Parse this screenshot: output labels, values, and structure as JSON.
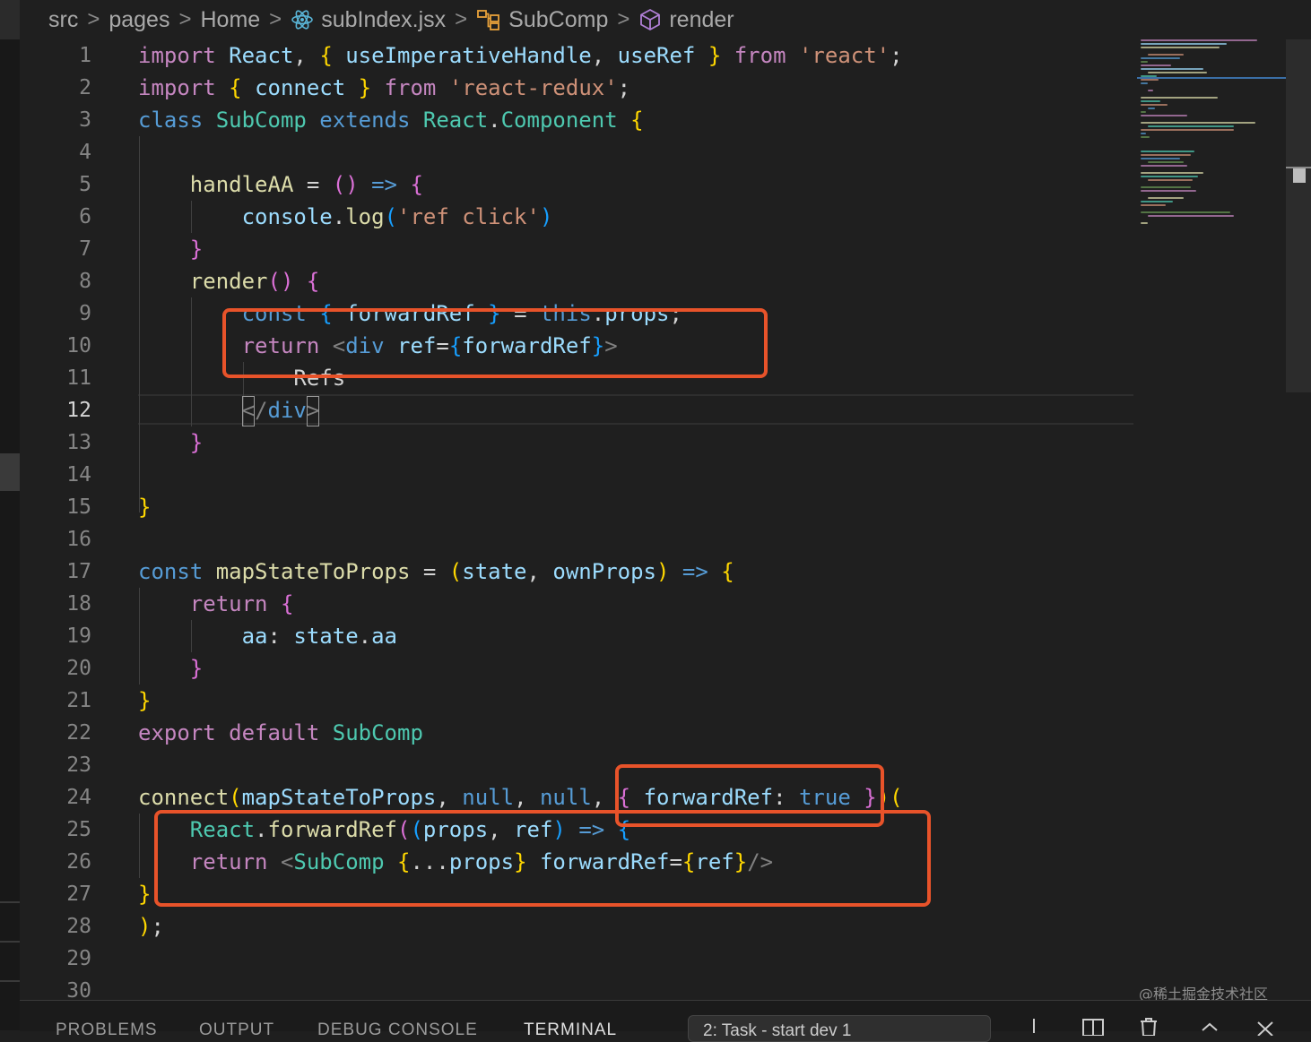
{
  "breadcrumb": [
    {
      "label": "src",
      "icon": null
    },
    {
      "label": "pages",
      "icon": null
    },
    {
      "label": "Home",
      "icon": null
    },
    {
      "label": "subIndex.jsx",
      "icon": "react-atom-icon"
    },
    {
      "label": "SubComp",
      "icon": "class-symbol-icon"
    },
    {
      "label": "render",
      "icon": "method-cube-icon"
    }
  ],
  "editor": {
    "active_line": 12,
    "line_numbers": [
      "1",
      "2",
      "3",
      "4",
      "5",
      "6",
      "7",
      "8",
      "9",
      "10",
      "11",
      "12",
      "13",
      "14",
      "15",
      "16",
      "17",
      "18",
      "19",
      "20",
      "21",
      "22",
      "23",
      "24",
      "25",
      "26",
      "27",
      "28",
      "29",
      "30"
    ],
    "lines": [
      [
        [
          "import ",
          "kw"
        ],
        [
          "React",
          "var"
        ],
        [
          ", ",
          "pl"
        ],
        [
          "{ ",
          "p1"
        ],
        [
          "useImperativeHandle",
          "var"
        ],
        [
          ", ",
          "pl"
        ],
        [
          "useRef",
          "var"
        ],
        [
          " }",
          "p1"
        ],
        [
          " from ",
          "kw"
        ],
        [
          "'react'",
          "str"
        ],
        [
          ";",
          "pl"
        ]
      ],
      [
        [
          "import ",
          "kw"
        ],
        [
          "{ ",
          "p1"
        ],
        [
          "connect",
          "var"
        ],
        [
          " }",
          "p1"
        ],
        [
          " from ",
          "kw"
        ],
        [
          "'react-redux'",
          "str"
        ],
        [
          ";",
          "pl"
        ]
      ],
      [
        [
          "class ",
          "st"
        ],
        [
          "SubComp ",
          "cl"
        ],
        [
          "extends ",
          "st"
        ],
        [
          "React",
          "cl"
        ],
        [
          ".",
          "pl"
        ],
        [
          "Component ",
          "cl"
        ],
        [
          "{",
          "p1"
        ]
      ],
      [],
      [
        [
          "    handleAA ",
          "fn"
        ],
        [
          "= ",
          "pl"
        ],
        [
          "() ",
          "p2"
        ],
        [
          "=> ",
          "st"
        ],
        [
          "{",
          "p2"
        ]
      ],
      [
        [
          "        console",
          "var"
        ],
        [
          ".",
          "pl"
        ],
        [
          "log",
          "fn"
        ],
        [
          "(",
          "p3"
        ],
        [
          "'ref click'",
          "str"
        ],
        [
          ")",
          "p3"
        ]
      ],
      [
        [
          "    }",
          "p2"
        ]
      ],
      [
        [
          "    render",
          "fn"
        ],
        [
          "() ",
          "p2"
        ],
        [
          "{",
          "p2"
        ]
      ],
      [
        [
          "        const ",
          "st"
        ],
        [
          "{ ",
          "p3"
        ],
        [
          "forwardRef ",
          "var"
        ],
        [
          "} ",
          "p3"
        ],
        [
          "= ",
          "pl"
        ],
        [
          "this",
          "st"
        ],
        [
          ".",
          "pl"
        ],
        [
          "props",
          "var"
        ],
        [
          ";",
          "pl"
        ]
      ],
      [
        [
          "        return ",
          "kw"
        ],
        [
          "<",
          "tg"
        ],
        [
          "div ",
          "st"
        ],
        [
          "ref",
          "var"
        ],
        [
          "=",
          "pl"
        ],
        [
          "{",
          "p3"
        ],
        [
          "forwardRef",
          "var"
        ],
        [
          "}",
          "p3"
        ],
        [
          ">",
          "tg"
        ]
      ],
      [
        [
          "            Refs",
          "pl"
        ]
      ],
      [
        [
          "        </",
          "tg"
        ],
        [
          "div",
          "st"
        ],
        [
          ">",
          "tg"
        ]
      ],
      [
        [
          "    }",
          "p2"
        ]
      ],
      [],
      [
        [
          "}",
          "p1"
        ]
      ],
      [],
      [
        [
          "const ",
          "st"
        ],
        [
          "mapStateToProps ",
          "fn"
        ],
        [
          "= ",
          "pl"
        ],
        [
          "(",
          "p1"
        ],
        [
          "state",
          "var"
        ],
        [
          ", ",
          "pl"
        ],
        [
          "ownProps",
          "var"
        ],
        [
          ") ",
          "p1"
        ],
        [
          "=> ",
          "st"
        ],
        [
          "{",
          "p1"
        ]
      ],
      [
        [
          "    return ",
          "kw"
        ],
        [
          "{",
          "p2"
        ]
      ],
      [
        [
          "        aa",
          "var"
        ],
        [
          ": ",
          "pl"
        ],
        [
          "state",
          "var"
        ],
        [
          ".",
          "pl"
        ],
        [
          "aa",
          "var"
        ]
      ],
      [
        [
          "    }",
          "p2"
        ]
      ],
      [
        [
          "}",
          "p1"
        ]
      ],
      [
        [
          "export ",
          "kw"
        ],
        [
          "default ",
          "kw"
        ],
        [
          "SubComp",
          "cl"
        ]
      ],
      [],
      [
        [
          "connect",
          "fn"
        ],
        [
          "(",
          "p1"
        ],
        [
          "mapStateToProps",
          "var"
        ],
        [
          ", ",
          "pl"
        ],
        [
          "null",
          "st"
        ],
        [
          ", ",
          "pl"
        ],
        [
          "null",
          "st"
        ],
        [
          ", ",
          "pl"
        ],
        [
          "{ ",
          "p2"
        ],
        [
          "forwardRef",
          "var"
        ],
        [
          ": ",
          "pl"
        ],
        [
          "true ",
          "st"
        ],
        [
          "}",
          "p2"
        ],
        [
          ")",
          "p1"
        ],
        [
          "(",
          "p1"
        ]
      ],
      [
        [
          "    React",
          "cl"
        ],
        [
          ".",
          "pl"
        ],
        [
          "forwardRef",
          "fn"
        ],
        [
          "(",
          "p2"
        ],
        [
          "(",
          "p3"
        ],
        [
          "props",
          "var"
        ],
        [
          ", ",
          "pl"
        ],
        [
          "ref",
          "var"
        ],
        [
          ") ",
          "p3"
        ],
        [
          "=> ",
          "st"
        ],
        [
          "{",
          "p3"
        ]
      ],
      [
        [
          "    return ",
          "kw"
        ],
        [
          "<",
          "tg"
        ],
        [
          "SubComp ",
          "cl"
        ],
        [
          "{",
          "p1"
        ],
        [
          "...",
          "pl"
        ],
        [
          "props",
          "var"
        ],
        [
          "} ",
          "p1"
        ],
        [
          "forwardRef",
          "var"
        ],
        [
          "=",
          "pl"
        ],
        [
          "{",
          "p1"
        ],
        [
          "ref",
          "var"
        ],
        [
          "}",
          "p1"
        ],
        [
          "/>",
          "tg"
        ]
      ],
      [
        [
          "}",
          "p1"
        ]
      ],
      [
        [
          ")",
          "p1"
        ],
        [
          ";",
          "pl"
        ]
      ],
      [],
      []
    ]
  },
  "panel": {
    "tabs": [
      "PROBLEMS",
      "OUTPUT",
      "DEBUG CONSOLE",
      "TERMINAL"
    ],
    "active_tab": "TERMINAL",
    "terminal_select": "2: Task - start dev 1",
    "actions": [
      "add-terminal-icon",
      "split-terminal-icon",
      "trash-icon",
      "maximize-chevron-icon",
      "close-icon"
    ]
  },
  "watermark": "@稀土掘金技术社区",
  "colors": {
    "background": "#1f1f1f",
    "annotation_red": "#e8532a",
    "keyword": "#c586c0",
    "storage": "#569cd6",
    "class": "#4ec9b0",
    "function": "#dcdcaa",
    "variable": "#9cdcfe",
    "string": "#ce9178"
  }
}
